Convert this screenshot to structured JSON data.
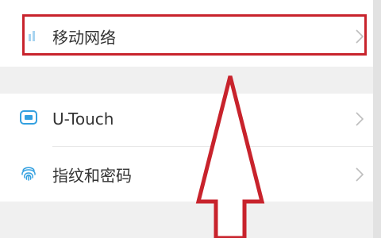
{
  "settings": {
    "items": [
      {
        "label": "移动网络",
        "icon": "signal-bars-icon"
      },
      {
        "label": "U-Touch",
        "icon": "utouch-icon"
      },
      {
        "label": "指纹和密码",
        "icon": "fingerprint-icon"
      }
    ]
  },
  "colors": {
    "highlight": "#c8232c",
    "icon_blue": "#33a0e0",
    "chevron": "#bdbdbd",
    "background": "#f0f0f0"
  },
  "annotation": {
    "highlighted_item": "移动网络",
    "arrow_direction": "up"
  }
}
